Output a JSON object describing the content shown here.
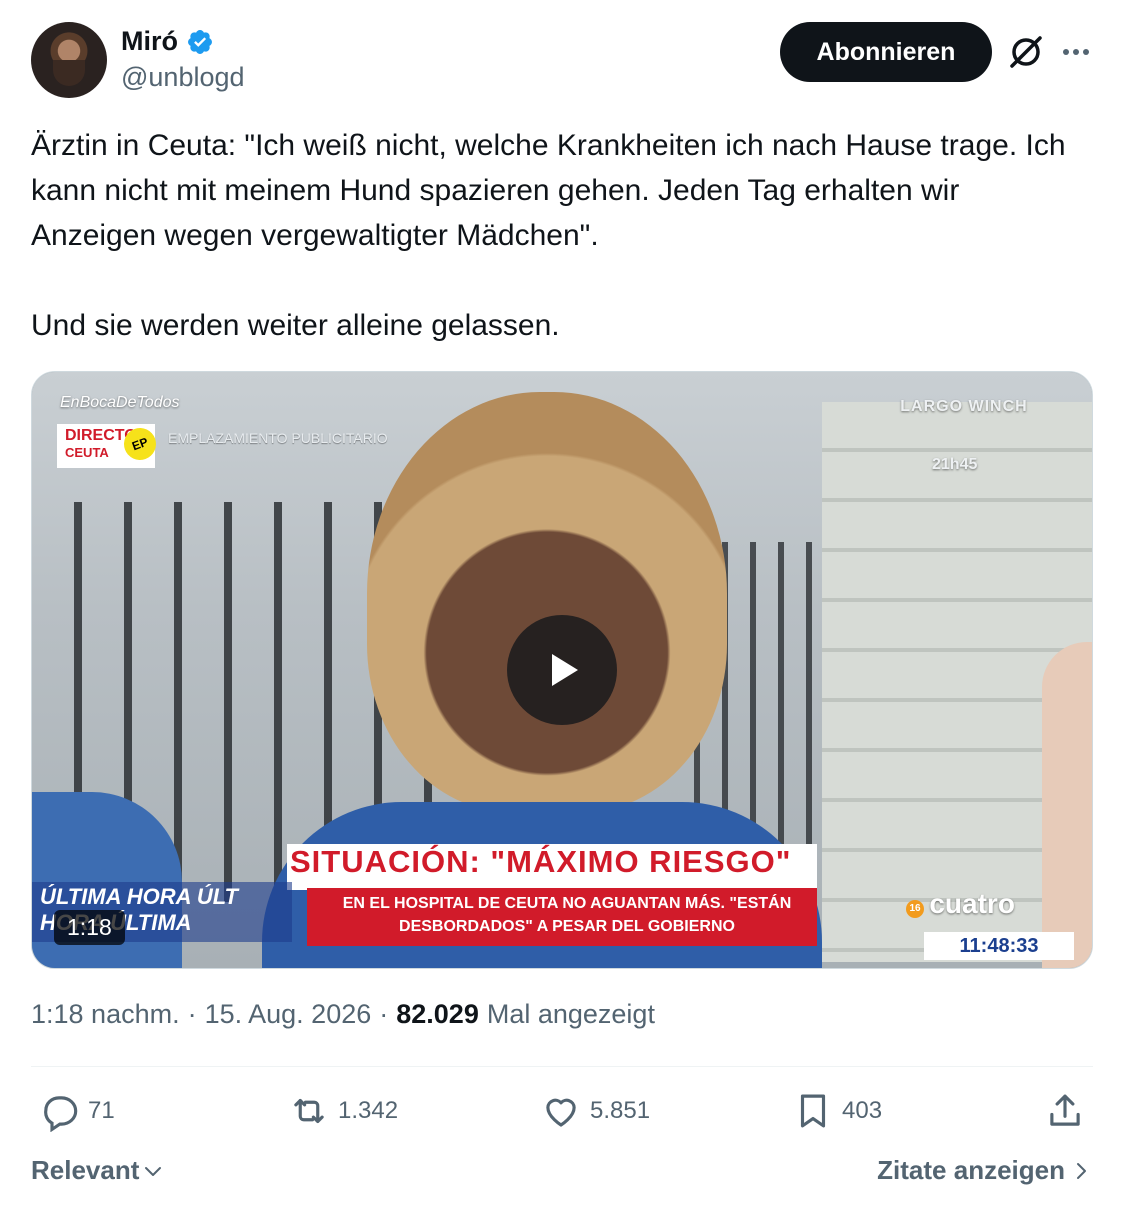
{
  "author": {
    "display_name": "Miró",
    "handle": "@unblogd",
    "verified": true
  },
  "actions": {
    "subscribe_label": "Abonnieren"
  },
  "tweet": {
    "text": "Ärztin in Ceuta: \"Ich weiß nicht, welche Krankheiten ich nach Hause trage. Ich kann nicht mit meinem Hund spazieren gehen. Jeden Tag erhalten wir Anzeigen wegen vergewaltigter Mädchen\".\n\nUnd sie werden weiter alleine gelassen."
  },
  "video": {
    "duration": "1:18",
    "overlay": {
      "channel": "EnBocaDeTodos",
      "live_label": "DIRECTO",
      "live_location": "CEUTA",
      "ep_badge": "EP",
      "placement": "EMPLAZAMIENTO PUBLICITARIO",
      "promo_title": "LARGO WINCH",
      "promo_time": "21h45",
      "headline": "SITUACIÓN: \"MÁXIMO RIESGO\"",
      "subline": "EN EL HOSPITAL DE CEUTA NO AGUANTAN MÁS. \"ESTÁN DESBORDADOS\" A PESAR DEL GOBIERNO",
      "ticker_1": "ÚLTIMA HORA   ÚLT",
      "ticker_2": "HORA   ÚLTIMA",
      "broadcaster": "cuatro",
      "age_rating": "16",
      "clock": "11:48:33"
    }
  },
  "meta": {
    "time": "1:18 nachm.",
    "separator": "·",
    "date": "15. Aug. 2026",
    "views": "82.029",
    "views_label": "Mal angezeigt"
  },
  "stats": {
    "replies": "71",
    "reposts": "1.342",
    "likes": "5.851",
    "bookmarks": "403"
  },
  "footer": {
    "sort_label": "Relevant",
    "quotes_label": "Zitate anzeigen"
  },
  "colors": {
    "accent": "#1d9bf0",
    "text_primary": "#0f1419",
    "text_secondary": "#536471",
    "button_bg": "#0f1419"
  }
}
